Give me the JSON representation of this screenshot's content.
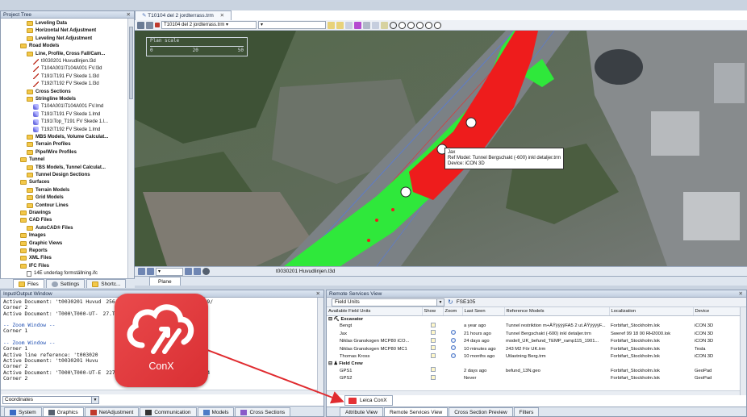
{
  "project_tree": {
    "title": "Project Tree",
    "items": [
      {
        "label": "Leveling Data",
        "type": "folder",
        "bold": true
      },
      {
        "label": "Horizontal Net Adjustment",
        "type": "folder",
        "bold": true
      },
      {
        "label": "Leveling Net Adjustment",
        "type": "folder",
        "bold": true
      },
      {
        "label": "Road Models",
        "type": "folder",
        "bold": true
      },
      {
        "label": "Line, Profile, Cross Fall/Cam...",
        "type": "folder",
        "bold": true
      },
      {
        "label": "t0030201 Huvudlinjen.l3d",
        "type": "line"
      },
      {
        "label": "T104A001\\T104A001 FV.l3d",
        "type": "line"
      },
      {
        "label": "T191\\T191 FV Skede 1.l3d",
        "type": "line"
      },
      {
        "label": "T192\\T192 FV Skede 1.l3d",
        "type": "line"
      },
      {
        "label": "Cross Sections",
        "type": "folder",
        "bold": true
      },
      {
        "label": "Stringline Models",
        "type": "folder",
        "bold": true
      },
      {
        "label": "T104A001\\T104A001 FV.lmd",
        "type": "string"
      },
      {
        "label": "T191\\T191 FV Skede 1.lmd",
        "type": "string"
      },
      {
        "label": "T191\\Top_T191 FV Skede 1.l...",
        "type": "string"
      },
      {
        "label": "T192\\T192 FV Skede 1.lmd",
        "type": "string"
      },
      {
        "label": "MBS Models, Volume Calculat...",
        "type": "folder",
        "bold": true
      },
      {
        "label": "Terrain Profiles",
        "type": "folder",
        "bold": true
      },
      {
        "label": "Pipe/Wire Profiles",
        "type": "folder",
        "bold": true
      },
      {
        "label": "Tunnel",
        "type": "folder",
        "bold": true
      },
      {
        "label": "TBS Models, Tunnel Calculat...",
        "type": "folder",
        "bold": true
      },
      {
        "label": "Tunnel Design Sections",
        "type": "folder",
        "bold": true
      },
      {
        "label": "Surfaces",
        "type": "folder",
        "bold": true
      },
      {
        "label": "Terrain Models",
        "type": "folder",
        "bold": true
      },
      {
        "label": "Grid Models",
        "type": "folder",
        "bold": true
      },
      {
        "label": "Contour Lines",
        "type": "folder",
        "bold": true
      },
      {
        "label": "Drawings",
        "type": "folder",
        "bold": true
      },
      {
        "label": "CAD Files",
        "type": "folder",
        "bold": true
      },
      {
        "label": "AutoCAD® Files",
        "type": "folder",
        "bold": true
      },
      {
        "label": "Images",
        "type": "folder",
        "bold": true
      },
      {
        "label": "Graphic Views",
        "type": "folder",
        "bold": true
      },
      {
        "label": "Reports",
        "type": "folder",
        "bold": true
      },
      {
        "label": "XML Files",
        "type": "folder",
        "bold": true
      },
      {
        "label": "IFC Files",
        "type": "folder",
        "bold": true
      },
      {
        "label": "14E underlag formställning.ifc",
        "type": "file"
      }
    ],
    "tabs": [
      "Files",
      "Settings",
      "Shortc..."
    ]
  },
  "map_view": {
    "doc_tab": "T10104 del 2 jordterrass.trm",
    "toolbar_combo": "T10104 del 2 jordterrass.trm",
    "scale_title": "Plan scale",
    "scale_ticks": [
      "0",
      "20",
      "50"
    ],
    "tooltip": {
      "line1": "Jax",
      "line2": "Ref Model: Tunnel Bergschakt (-600) inkl detaljer.trm",
      "line3": "Device: iCON 3D"
    },
    "status_label": "t0030201 Huvudlinjen.l3d",
    "bottom_tab": "Plane"
  },
  "io_window": {
    "title": "Input/Output Window",
    "lines": [
      {
        "text": "Active Document: 't0030201 Huvud",
        "tail": "256; (E)165 234,244; (S)(Station)9/",
        "c": false
      },
      {
        "text": "Corner 2",
        "tail": "",
        "c": false
      },
      {
        "text": "Active Document: 'T000\\T000-UT-",
        "tail": "27.TRM'",
        "c": false
      },
      {
        "text": "",
        "tail": "",
        "c": false
      },
      {
        "text": "-- Zoom Window --",
        "tail": "",
        "c": true
      },
      {
        "text": "Corner 1",
        "tail": "",
        "c": false
      },
      {
        "text": "",
        "tail": "",
        "c": false
      },
      {
        "text": "-- Zoom Window --",
        "tail": "",
        "c": true
      },
      {
        "text": "Corner 1",
        "tail": "",
        "c": false
      },
      {
        "text": "Active line reference: 't003020",
        "tail": "",
        "c": false
      },
      {
        "text": "Active Document: 't0030201 Huvu",
        "tail": "",
        "c": false
      },
      {
        "text": "Corner 2",
        "tail": "",
        "c": false
      },
      {
        "text": "Active Document: 'T000\\T000-UT-E",
        "tail": "227.TRM' : (N)6 572 430,417 (E)144",
        "c": false
      },
      {
        "text": "Corner 2",
        "tail": "",
        "c": false
      }
    ],
    "combo_value": "Coordinates",
    "tabs": [
      "System",
      "Graphics",
      "NetAdjustment",
      "Communication",
      "Models",
      "Cross Sections"
    ]
  },
  "remote_view": {
    "title": "Remote Services View",
    "filter_value": "Field Units",
    "server_label": "FSE105",
    "columns": [
      "Available Field Units",
      "Show",
      "Zoom",
      "Last Seen",
      "Reference Models",
      "Localization",
      "Device"
    ],
    "groups": [
      {
        "name": "Excavator",
        "rows": [
          {
            "unit": "Bengt",
            "zoom": false,
            "last_seen": "a year ago",
            "ref": "Tunnel restriktion m+ÄŸÿÿÿÿFA5 2 ut.ÄŸÿÿÿÿF...",
            "loc": "Forbifart_Stockholm.lok",
            "device": "iCON 3D"
          },
          {
            "unit": "Jax",
            "zoom": true,
            "last_seen": "21 hours ago",
            "ref": "Tunnel Bergschakt (-600) inkl detaljer.trm",
            "loc": "Sweref 99 18 00 RH2000.lok",
            "device": "iCON 3D"
          },
          {
            "unit": "Niklas Granskogen MCP80 iCO...",
            "zoom": true,
            "last_seen": "24 days ago",
            "ref": "modell_UK_befund_TEMP_ramp115_1901...",
            "loc": "Forbifart_Stockholm.lok",
            "device": "iCON 3D"
          },
          {
            "unit": "Niklas Granskogen MCP80 MC1",
            "zoom": true,
            "last_seen": "10 minutes ago",
            "ref": "243 M2 För UK.trm",
            "loc": "Forbifart_Stockholm.lok",
            "device": "Tesla"
          },
          {
            "unit": "Thomas Kross",
            "zoom": true,
            "last_seen": "10 months ago",
            "ref": "Utlastning Berg.trm",
            "loc": "Forbifart_Stockholm.lok",
            "device": "iCON 3D"
          }
        ]
      },
      {
        "name": "Field Crew",
        "rows": [
          {
            "unit": "GPS1",
            "zoom": false,
            "last_seen": "2 days ago",
            "ref": "befund_13N.geo",
            "loc": "Forbifart_Stockholm.lok",
            "device": "GeoPad"
          },
          {
            "unit": "GPS2",
            "zoom": false,
            "last_seen": "Never",
            "ref": "",
            "loc": "Forbifart_Stockholm.lok",
            "device": "GeoPad"
          }
        ]
      }
    ],
    "leica_tab": "Leica ConX",
    "tabs": [
      "Attribute View",
      "Remote Services View",
      "Cross Section Preview",
      "Filters"
    ]
  },
  "conx_badge": {
    "label": "ConX",
    "color": "#e03a3d"
  },
  "colors": {
    "accent_red": "#e53b3d",
    "model_green": "#2fe83b",
    "model_red": "#ee1c1c"
  }
}
